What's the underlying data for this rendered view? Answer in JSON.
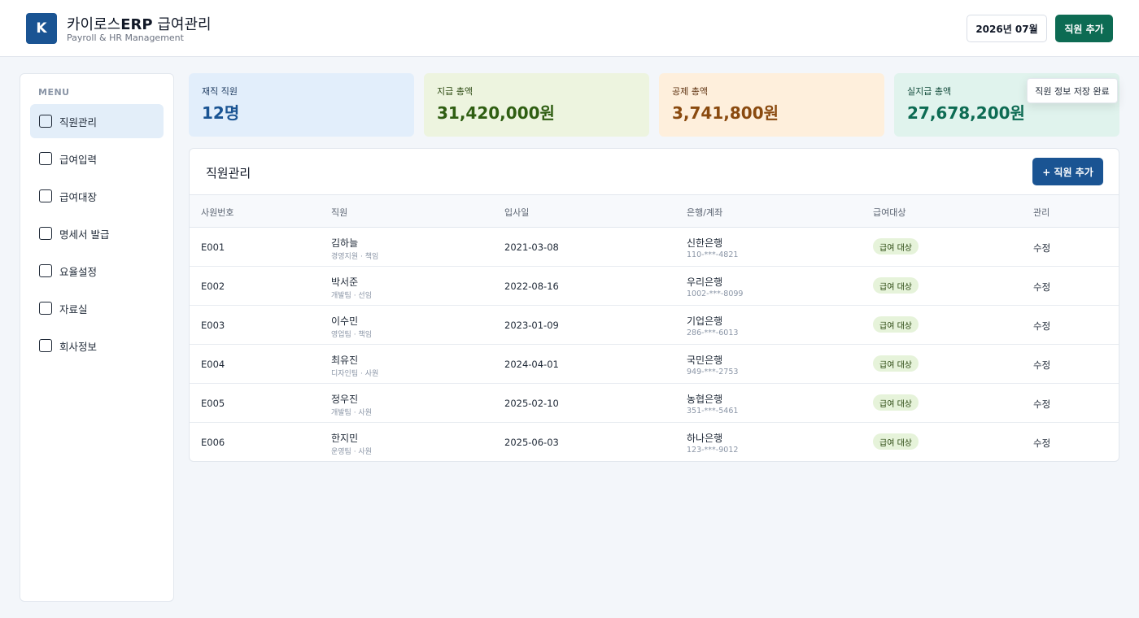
{
  "header": {
    "logo_letter": "K",
    "title_prefix": "카이로스",
    "title_bold": "ERP",
    "title_suffix": " 급여관리",
    "subtitle": "Payroll & HR Management",
    "month_label": "2026년 07월",
    "add_employee_label": "직원 추가"
  },
  "sidebar": {
    "menu_title": "MENU",
    "items": [
      {
        "label": "직원관리",
        "active": true
      },
      {
        "label": "급여입력",
        "active": false
      },
      {
        "label": "급여대장",
        "active": false
      },
      {
        "label": "명세서 발급",
        "active": false
      },
      {
        "label": "요율설정",
        "active": false
      },
      {
        "label": "자료실",
        "active": false
      },
      {
        "label": "회사정보",
        "active": false
      }
    ]
  },
  "stats": [
    {
      "label": "재직 직원",
      "value": "12명"
    },
    {
      "label": "지급 총액",
      "value": "31,420,000원"
    },
    {
      "label": "공제 총액",
      "value": "3,741,800원"
    },
    {
      "label": "실지급 총액",
      "value": "27,678,200원"
    }
  ],
  "toast": {
    "message": "직원 정보 저장 완료"
  },
  "panel": {
    "title": "직원관리",
    "add_button": "+ 직원 추가",
    "columns": [
      "사원번호",
      "직원",
      "입사일",
      "은행/계좌",
      "급여대상",
      "관리"
    ],
    "rows": [
      {
        "id": "E001",
        "name": "김하늘",
        "dept": "경영지원 · 책임",
        "date": "2021-03-08",
        "bank": "신한은행",
        "account": "110-***-4821",
        "badge": "급여 대상",
        "action": "수정"
      },
      {
        "id": "E002",
        "name": "박서준",
        "dept": "개발팀 · 선임",
        "date": "2022-08-16",
        "bank": "우리은행",
        "account": "1002-***-8099",
        "badge": "급여 대상",
        "action": "수정"
      },
      {
        "id": "E003",
        "name": "이수민",
        "dept": "영업팀 · 책임",
        "date": "2023-01-09",
        "bank": "기업은행",
        "account": "286-***-6013",
        "badge": "급여 대상",
        "action": "수정"
      },
      {
        "id": "E004",
        "name": "최유진",
        "dept": "디자인팀 · 사원",
        "date": "2024-04-01",
        "bank": "국민은행",
        "account": "949-***-2753",
        "badge": "급여 대상",
        "action": "수정"
      },
      {
        "id": "E005",
        "name": "정우진",
        "dept": "개발팀 · 사원",
        "date": "2025-02-10",
        "bank": "농협은행",
        "account": "351-***-5461",
        "badge": "급여 대상",
        "action": "수정"
      },
      {
        "id": "E006",
        "name": "한지민",
        "dept": "운영팀 · 사원",
        "date": "2025-06-03",
        "bank": "하나은행",
        "account": "123-***-9012",
        "badge": "급여 대상",
        "action": "수정"
      }
    ]
  }
}
